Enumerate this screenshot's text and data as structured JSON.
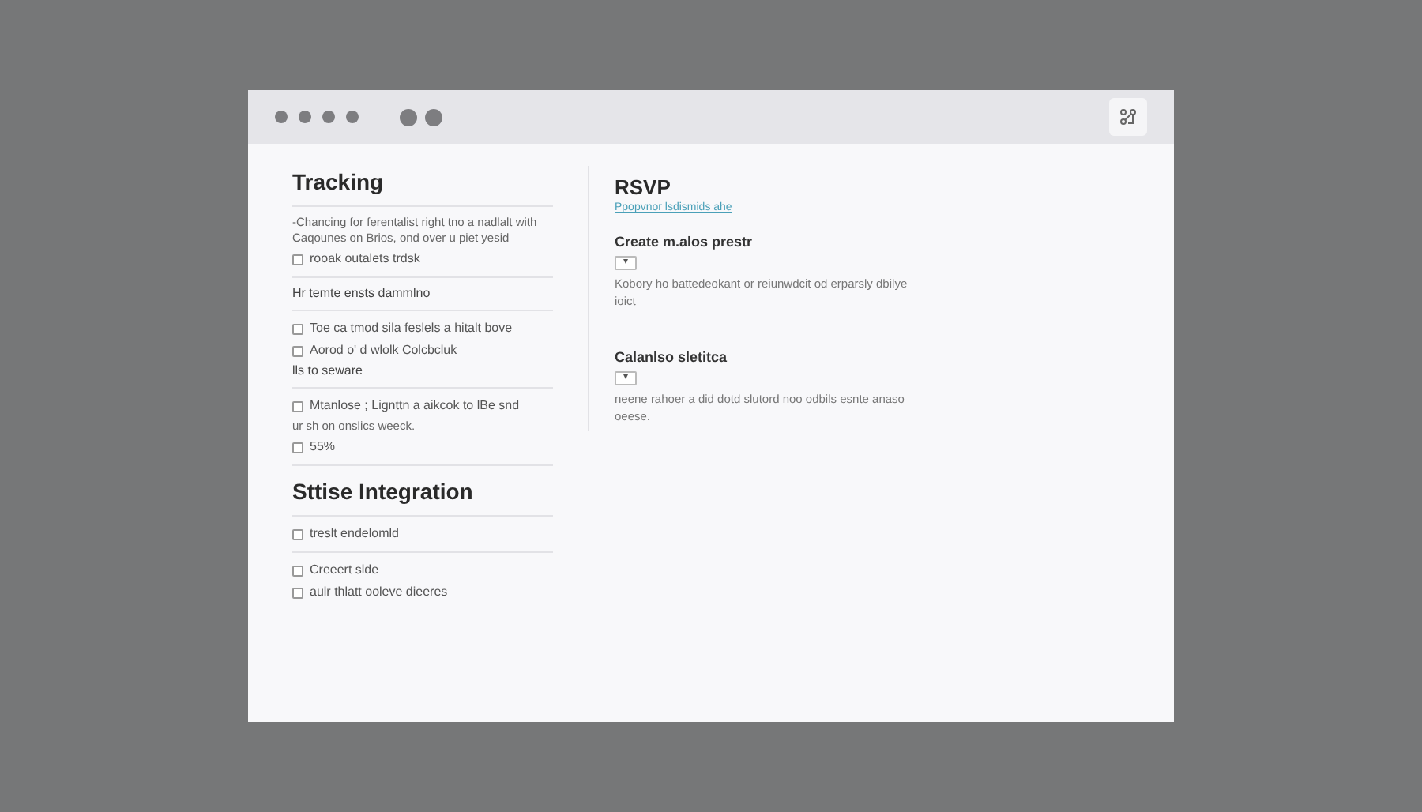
{
  "left_panel": {
    "items": [
      {
        "kind": "heading",
        "text": "Tracking"
      },
      {
        "kind": "rule"
      },
      {
        "kind": "paragraph",
        "text": "-Chancing for ferentalist right tno a nadlalt with Caqounes on Brios, ond over u piet yesid"
      },
      {
        "kind": "checkbox",
        "text": "rooak outalets trdsk",
        "checked": false
      },
      {
        "kind": "rule"
      },
      {
        "kind": "text",
        "text": "Hr temte ensts dammlno"
      },
      {
        "kind": "rule"
      },
      {
        "kind": "checkbox",
        "text": "Toe ca tmod sila feslels a hitalt bove",
        "checked": false
      },
      {
        "kind": "checkbox",
        "text": "Aorod o' d wlolk Colcbcluk",
        "checked": false
      },
      {
        "kind": "text",
        "text": "lls to seware"
      },
      {
        "kind": "rule"
      },
      {
        "kind": "checkbox",
        "text": "Mtanlose ; Lignttn a aikcok to lBe snd",
        "checked": false
      },
      {
        "kind": "paragraph",
        "text": "ur sh on onslics weeck."
      },
      {
        "kind": "checkbox",
        "text": "55%",
        "checked": false
      },
      {
        "kind": "rule"
      },
      {
        "kind": "heading",
        "text": "Sttise Integration"
      },
      {
        "kind": "rule"
      },
      {
        "kind": "checkbox",
        "text": "treslt endelomld",
        "checked": false
      },
      {
        "kind": "rule"
      },
      {
        "kind": "checkbox",
        "text": "Creeert slde",
        "checked": false
      },
      {
        "kind": "checkbox",
        "text": "aulr thlatt ooleve dieeres",
        "checked": false
      }
    ]
  },
  "right_panel": {
    "title": "RSVP",
    "link": "Ppopvnor lsdismids ahe",
    "sections": [
      {
        "title": "Create m.alos prestr",
        "select": "▾",
        "description": "Kobory ho battedeokant or reiunwdcit od erparsly dbilye ioict"
      },
      {
        "title": "Calanlso sletitca",
        "select": "▾",
        "description": "neene rahoer a did dotd slutord noo odbils esnte anaso oeese."
      }
    ]
  }
}
